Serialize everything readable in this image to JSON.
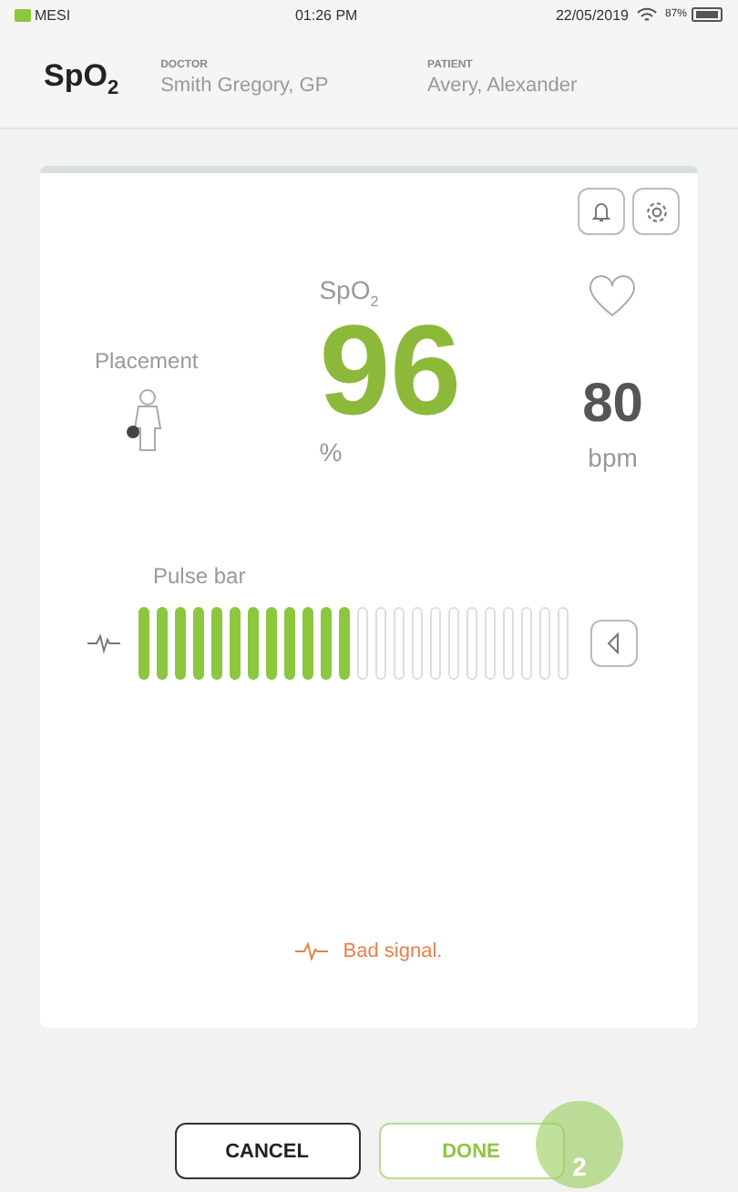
{
  "status_bar": {
    "carrier": "MESI",
    "time": "01:26 PM",
    "date": "22/05/2019",
    "battery": "87%"
  },
  "header": {
    "title": "SpO$_{2}$",
    "doctor_label": "DOCTOR",
    "doctor": "Smith Gregory, GP",
    "patient_label": "PATIENT",
    "patient": "Avery, Alexander"
  },
  "placement": {
    "label": "Placement"
  },
  "spo2": {
    "label": "SpO$_{2}$",
    "value": "96",
    "unit": "%"
  },
  "pulse": {
    "value": "80",
    "unit": "bpm"
  },
  "pulse_bar": {
    "label": "Pulse bar",
    "level": 0.5
  },
  "signal_message": "Bad signal.",
  "buttons": [
    {
      "label": "CANCEL",
      "kind": "secondary"
    },
    {
      "label": "DONE",
      "kind": "primary"
    }
  ],
  "touch_badge": "2"
}
